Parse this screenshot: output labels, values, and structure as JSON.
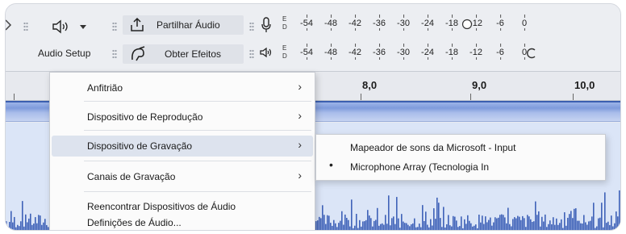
{
  "toolbar": {
    "audio_setup_label": "Audio Setup",
    "share_audio_label": "Partilhar Áudio",
    "get_effects_label": "Obter Efeitos"
  },
  "meters": {
    "record": {
      "channels": [
        "E",
        "D"
      ],
      "ticks": [
        "-54",
        "-48",
        "-42",
        "-36",
        "-30",
        "-24",
        "-18",
        "-12",
        "-6",
        "0"
      ]
    },
    "playback": {
      "channels": [
        "E",
        "D"
      ],
      "ticks": [
        "-54",
        "-48",
        "-42",
        "-36",
        "-30",
        "-24",
        "-18",
        "-12",
        "-6",
        "0"
      ]
    }
  },
  "timeline": {
    "labels": [
      "8,0",
      "9,0",
      "10,0"
    ]
  },
  "menu": {
    "items": [
      {
        "label": "Anfitrião",
        "has_submenu": true
      },
      {
        "label": "Dispositivo de Reprodução",
        "has_submenu": true
      },
      {
        "label": "Dispositivo de Gravação",
        "has_submenu": true,
        "highlighted": true
      },
      {
        "label": "Canais de Gravação",
        "has_submenu": true
      },
      {
        "label": "Reencontrar Dispositivos de Áudio",
        "has_submenu": false
      },
      {
        "label": "Definições de Áudio...",
        "has_submenu": false
      }
    ]
  },
  "submenu": {
    "items": [
      {
        "label": "Mapeador de sons da Microsoft - Input",
        "selected": false
      },
      {
        "label": "Microphone Array (Tecnologia In",
        "selected": true
      }
    ]
  },
  "colors": {
    "track_bg": "#dbe5f7",
    "waveform": "#3f62b8",
    "highlight": "#dde3ee"
  }
}
